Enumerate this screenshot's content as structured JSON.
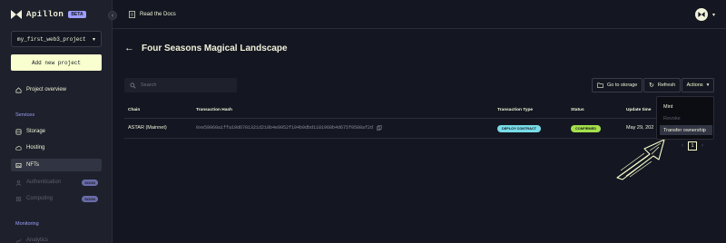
{
  "app": {
    "name": "Apillon",
    "badge": "BETA"
  },
  "sidebar": {
    "project_select": "my_first_web3_project",
    "add_project_label": "Add new project",
    "overview_label": "Project overview",
    "services_label": "Services",
    "items": [
      {
        "label": "Storage",
        "icon": "database-icon",
        "active": false,
        "disabled": false
      },
      {
        "label": "Hosting",
        "icon": "cloud-icon",
        "active": false,
        "disabled": false
      },
      {
        "label": "NFTs",
        "icon": "image-icon",
        "active": true,
        "disabled": false
      },
      {
        "label": "Authentication",
        "icon": "user-icon",
        "active": false,
        "disabled": true,
        "badge": "SOON"
      },
      {
        "label": "Computing",
        "icon": "cpu-icon",
        "active": false,
        "disabled": true,
        "badge": "SOON"
      }
    ],
    "monitoring_label": "Monitoring",
    "monitoring_items": [
      {
        "label": "Analytics"
      }
    ]
  },
  "topbar": {
    "docs_label": "Read the Docs"
  },
  "main": {
    "title": "Four Seasons Magical Landscape",
    "search_placeholder": "Search",
    "buttons": {
      "storage": "Go to storage",
      "refresh": "Refresh",
      "actions": "Actions"
    },
    "table": {
      "columns": [
        "Chain",
        "Transaction Hash",
        "Transaction Type",
        "Status",
        "Update time"
      ],
      "rows": [
        {
          "chain": "ASTAR (Mainnet)",
          "hash": "0xe59960a1ffa19d6701321d210b4e9052f194b9dbd1181960b4d675f0508af2d",
          "type": "DEPLOY CONTRACT",
          "status": "CONFIRMED",
          "time": "May 29, 202"
        }
      ]
    },
    "dropdown": {
      "items": [
        {
          "label": "Mint",
          "disabled": false,
          "hover": false
        },
        {
          "label": "Revoke",
          "disabled": true,
          "hover": false
        },
        {
          "label": "Transfer ownership",
          "disabled": false,
          "hover": true
        }
      ]
    },
    "pagination": {
      "current": "1"
    }
  },
  "colors": {
    "background": "#141721",
    "sidebar": "#1e212b",
    "accent_yellow": "#f9ffcf",
    "accent_purple": "#9d9eff",
    "badge_blue": "#78dce8",
    "badge_green": "#a5e04c"
  }
}
